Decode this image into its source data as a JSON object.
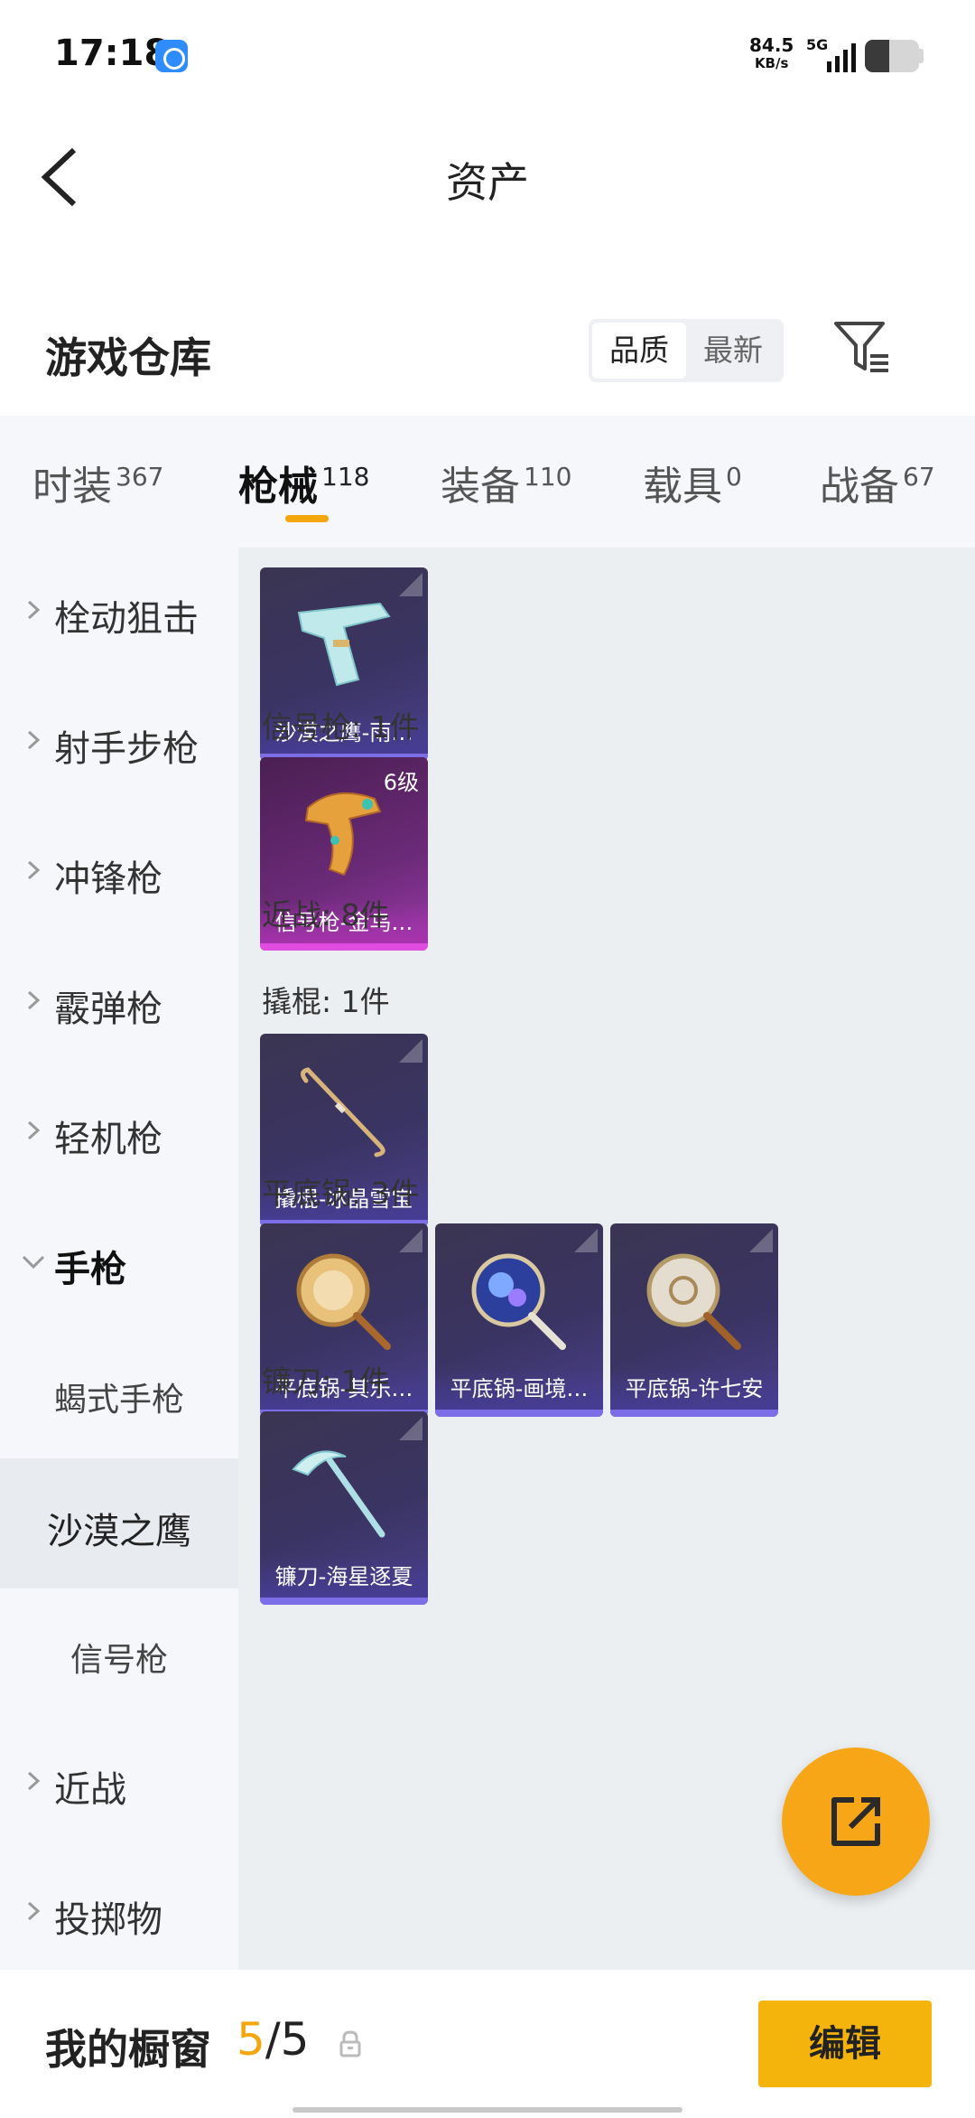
{
  "status_bar": {
    "time": "17:18",
    "speed_value": "84.5",
    "speed_unit": "KB/s",
    "network": "5G",
    "battery_level": 0.45
  },
  "header": {
    "title": "资产"
  },
  "warehouse": {
    "title": "游戏仓库",
    "sort_quality": "品质",
    "sort_newest": "最新"
  },
  "tabs": [
    {
      "label": "时装",
      "count": "367"
    },
    {
      "label": "枪械",
      "count": "118"
    },
    {
      "label": "装备",
      "count": "110"
    },
    {
      "label": "载具",
      "count": "0"
    },
    {
      "label": "战备",
      "count": "67"
    }
  ],
  "sidebar": {
    "items": [
      "栓动狙击",
      "射手步枪",
      "冲锋枪",
      "霰弹枪",
      "轻机枪",
      "手枪",
      "近战",
      "投掷物"
    ],
    "sub_items": [
      "蝎式手枪",
      "沙漠之鹰",
      "信号枪"
    ]
  },
  "content": {
    "cards": [
      {
        "name": "沙漠之鹰-雨…"
      },
      {
        "name": "信号枪-金乌…",
        "level": "6级"
      },
      {
        "name": "撬棍-冰晶雪宝"
      },
      {
        "name": "平底锅-其乐…"
      },
      {
        "name": "平底锅-画境…"
      },
      {
        "name": "平底锅-许七安"
      },
      {
        "name": "镰刀-海星逐夏"
      }
    ],
    "groups": [
      "信号枪: 1件",
      "近战: 8件",
      "撬棍: 1件",
      "平底锅: 3件",
      "镰刀: 1件"
    ]
  },
  "bottom": {
    "label": "我的橱窗",
    "current": "5",
    "total": "/5",
    "edit": "编辑"
  },
  "colors": {
    "accent": "#f4a70c",
    "button": "#f5b40b",
    "card_blue": "#3a3463",
    "card_purple": "#6b2a78"
  }
}
